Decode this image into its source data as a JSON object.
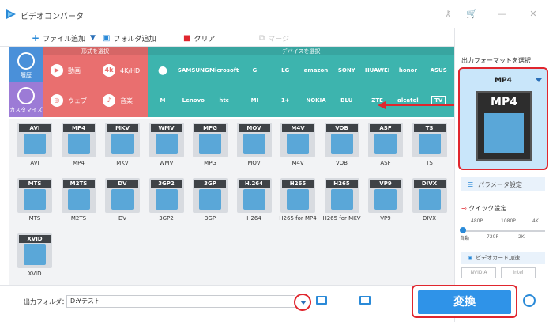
{
  "window": {
    "title": "ビデオコンバータ"
  },
  "toolbar": {
    "add_file": "ファイル追加",
    "add_folder": "フォルダ追加",
    "clear": "クリア",
    "merge": "マージ"
  },
  "categories": {
    "history": "履歴",
    "custom": "カスタマイズ",
    "formats_header": "形式を選択",
    "devices_header": "デバイスを選択",
    "format_buttons": [
      {
        "label": "動画",
        "symbol": "▶"
      },
      {
        "label": "4K/HD",
        "symbol": "4k"
      },
      {
        "label": "ウェブ",
        "symbol": "◎"
      },
      {
        "label": "音楽",
        "symbol": "♪"
      }
    ],
    "devices_row1": [
      "",
      "SAMSUNG",
      "Microsoft",
      "G",
      "LG",
      "amazon",
      "SONY",
      "HUAWEI",
      "honor",
      "ASUS"
    ],
    "devices_row2": [
      "M",
      "Lenovo",
      "htc",
      "MI",
      "1+",
      "NOKIA",
      "BLU",
      "ZTE",
      "alcatel",
      "TV"
    ],
    "device_icons": {
      "apple": "apple-icon",
      "tv": "tv-icon"
    }
  },
  "formats": [
    {
      "badge": "AVI",
      "label": "AVI"
    },
    {
      "badge": "MP4",
      "label": "MP4"
    },
    {
      "badge": "MKV",
      "label": "MKV"
    },
    {
      "badge": "WMV",
      "label": "WMV"
    },
    {
      "badge": "MPG",
      "label": "MPG"
    },
    {
      "badge": "MOV",
      "label": "MOV"
    },
    {
      "badge": "M4V",
      "label": "M4V"
    },
    {
      "badge": "VOB",
      "label": "VOB"
    },
    {
      "badge": "ASF",
      "label": "ASF"
    },
    {
      "badge": "TS",
      "label": "TS"
    },
    {
      "badge": "MTS",
      "label": "MTS"
    },
    {
      "badge": "M2TS",
      "label": "M2TS"
    },
    {
      "badge": "DV",
      "label": "DV"
    },
    {
      "badge": "3GP2",
      "label": "3GP2"
    },
    {
      "badge": "3GP",
      "label": "3GP"
    },
    {
      "badge": "H.264",
      "label": "H264"
    },
    {
      "badge": "H265",
      "label": "H265 for MP4"
    },
    {
      "badge": "H265",
      "label": "H265 for MKV"
    },
    {
      "badge": "VP9",
      "label": "VP9"
    },
    {
      "badge": "DIVX",
      "label": "DIVX"
    },
    {
      "badge": "XVID",
      "label": "XVID"
    }
  ],
  "output": {
    "label": "出力フォルダ：",
    "path": "D:¥テスト"
  },
  "right_panel": {
    "title": "出力フォーマットを選択",
    "selected_format": "MP4",
    "params_button": "パラメータ設定",
    "quick_settings": "クイック設定",
    "quality_top": [
      "480P",
      "1080P",
      "4K"
    ],
    "quality_bottom": [
      "自動",
      "720P",
      "2K"
    ],
    "gpu_label": "ビデオカード加速",
    "vendors": [
      "NVIDIA",
      "intel"
    ]
  },
  "convert_button": "変換",
  "colors": {
    "accent_red": "#e0262e",
    "teal": "#3db4ae",
    "formats_red": "#e96f6f",
    "blue": "#2f93e8"
  }
}
